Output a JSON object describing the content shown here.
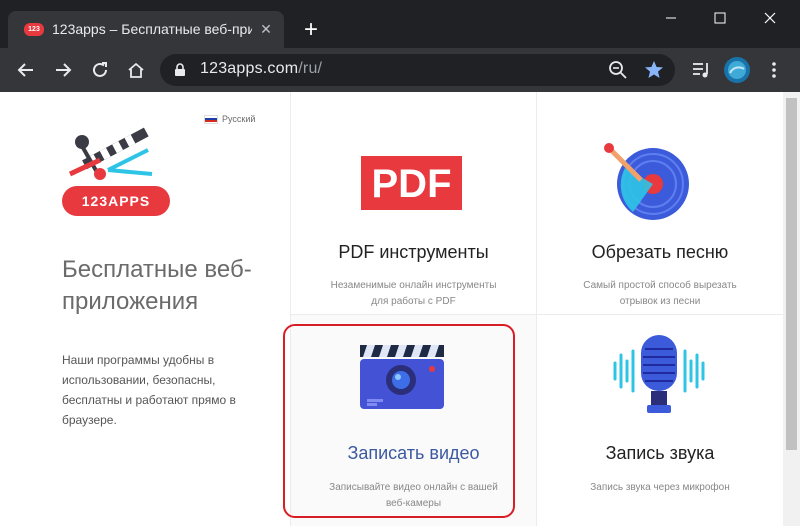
{
  "browser": {
    "tab": {
      "favicon_text": "123",
      "title": "123apps – Бесплатные веб-прил",
      "close_label": "✕"
    },
    "new_tab_label": "+",
    "window_controls": {
      "minimize": "—",
      "maximize": "☐",
      "close": "✕"
    },
    "address": {
      "host": "123apps.com",
      "path": "/ru/"
    }
  },
  "page": {
    "language": "Русский",
    "logo_text": "123APPS",
    "hero_title": "Бесплатные веб-приложения",
    "hero_description": "Наши программы удобны в использовании, безопасны, бесплатны и работают прямо в браузере.",
    "cards": [
      {
        "title": "PDF инструменты",
        "desc_line1": "Незаменимые онлайн инструменты",
        "desc_line2": "для работы с PDF",
        "icon_text": "PDF"
      },
      {
        "title": "Обрезать песню",
        "desc_line1": "Самый простой способ вырезать",
        "desc_line2": "отрывок из песни"
      },
      {
        "title": "Записать видео",
        "desc_line1": "Записывайте видео онлайн с вашей",
        "desc_line2": "веб-камеры"
      },
      {
        "title": "Запись звука",
        "desc_line1": "Запись звука через микрофон",
        "desc_line2": ""
      }
    ]
  },
  "colors": {
    "brand_red": "#e8393f",
    "highlight_red": "#d81e24",
    "video_title_blue": "#3c59a0",
    "icon_blue": "#3b5bdb",
    "icon_cyan": "#2ec4e6"
  }
}
